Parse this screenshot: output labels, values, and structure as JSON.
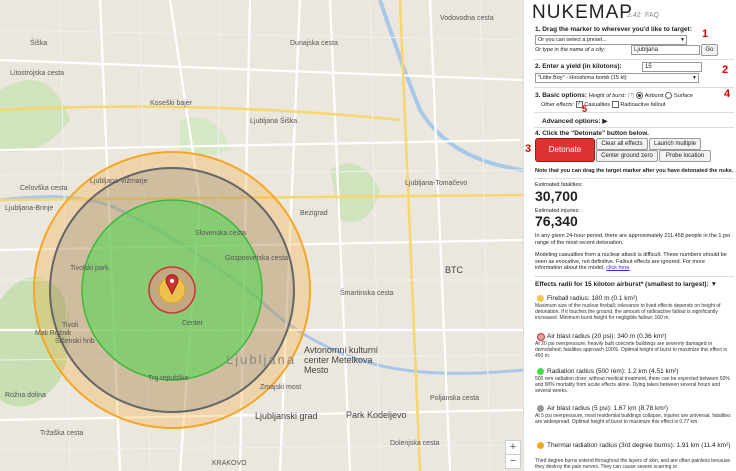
{
  "app": {
    "title": "NUKEMAP",
    "version": "2.42",
    "faq": "FAQ"
  },
  "map": {
    "city_label": "Ljubljana",
    "labels": [
      "Šiška",
      "Ljubljana Šiška",
      "Litostrojska cesta",
      "Šišenski hrib",
      "Dunajska cesta",
      "BTC",
      "Avtonomni kulturni center Metelkova Mesto",
      "Zmajski most",
      "Ljubljanski grad",
      "Park Kodeljevo",
      "KRAKOVO",
      "Tivoli",
      "Mali Rožnik",
      "Center",
      "Trg republike",
      "Vodovodna cesta",
      "Ljubljana-Tomačevo",
      "Ljubljana-Brinje",
      "Tivolski park",
      "Koseški bajer",
      "Bezigrad",
      "Ljubljana-Vižmarje",
      "Gosposvetska cesta",
      "Slovenska cesta",
      "Šmartinska cesta",
      "Poljanska cesta",
      "Dolenjska cesta",
      "Ljubljana",
      "Tržaška cesta",
      "Celovška cesta",
      "Rožna dolina"
    ],
    "zoom_in": "+",
    "zoom_out": "−",
    "colors": {
      "thermal": "#f5a623",
      "air5": "#808080",
      "radiation": "#4cd94c",
      "air20": "#d66",
      "fireball": "#f2c94c"
    }
  },
  "step1": {
    "label": "1. Drag the marker to wherever you'd like to target:",
    "preset_placeholder": "Or you can select a preset...",
    "city_label": "Or type in the name of a city:",
    "city_value": "Ljubljana",
    "go": "Go",
    "marker": "1"
  },
  "step2": {
    "label": "2. Enter a yield (in kilotons):",
    "yield_value": "15",
    "preset_value": "\"Little Boy\" - Hiroshima bomb (15 kt)",
    "marker": "2"
  },
  "step3": {
    "label": "3. Basic options:",
    "height_label": "Height of burst:",
    "help": "(?)",
    "airburst": "Airburst",
    "surface": "Surface",
    "other_label": "Other effects:",
    "casualties": "Casualties",
    "fallout": "Radioactive fallout",
    "marker": "4",
    "marker5": "5"
  },
  "advanced": {
    "label": "Advanced options:",
    "arrow": "▶"
  },
  "step4": {
    "label": "4. Click the \"Detonate\" button below.",
    "detonate": "Detonate",
    "marker": "3",
    "clear": "Clear all effects",
    "launch": "Launch multiple",
    "center": "Center ground zero",
    "probe": "Probe location"
  },
  "note": "Note that you can drag the target marker after you have detonated the nuke.",
  "fatalities": {
    "label": "Estimated fatalities:",
    "value": "30,700"
  },
  "injuries": {
    "label": "Estimated injuries:",
    "value": "76,340"
  },
  "daytime": "In any given 24-hour period, there are approximately 211,458 people in the 1 psi range of the most recent detonation.",
  "disclaimer_text": "Modeling casualties from a nuclear attack is difficult. These numbers should be seen as evocative, not definitive. Fallout effects are ignored. For more information about the model,",
  "click_here": "click here",
  "effects_header": "Effects radii for 15 kiloton airburst* (smallest to largest):",
  "effects_arrow": "▼",
  "effects": [
    {
      "title": "Fireball radius: 180 m (0.1 km²)",
      "desc": "Maximum size of the nuclear fireball; relevance to lived effects depends on height of detonation. If it touches the ground, the amount of radioactive fallout is significantly increased. Minimum burst height for negligible fallout: 160 m.",
      "color": "#f2c94c"
    },
    {
      "title": "Air blast radius (20 psi): 340 m (0.36 km²)",
      "desc": "At 20 psi overpressure, heavily built concrete buildings are severely damaged or demolished; fatalities approach 100%. Optimal height of burst to maximize this effect is 450 m.",
      "color": "#e8a0a0"
    },
    {
      "title": "Radiation radius (500 rem): 1.2 km (4.51 km²)",
      "desc": "500 rem radiation dose; without medical treatment, there can be expected between 50% and 90% mortality from acute effects alone. Dying takes between several hours and several weeks.",
      "color": "#4cd94c"
    },
    {
      "title": "Air blast radius (5 psi): 1.67 km (8.78 km²)",
      "desc": "At 5 psi overpressure, most residential buildings collapse, injuries are universal, fatalities are widespread. Optimal height of burst to maximize this effect is 0.77 km.",
      "color": "#999999"
    },
    {
      "title": "Thermal radiation radius (3rd degree burns): 1.91 km (11.4 km²)",
      "desc": "Third degree burns extend throughout the layers of skin, and are often painless because they destroy the pain nerves. They can cause severe scarring or",
      "color": "#f5a623"
    }
  ]
}
